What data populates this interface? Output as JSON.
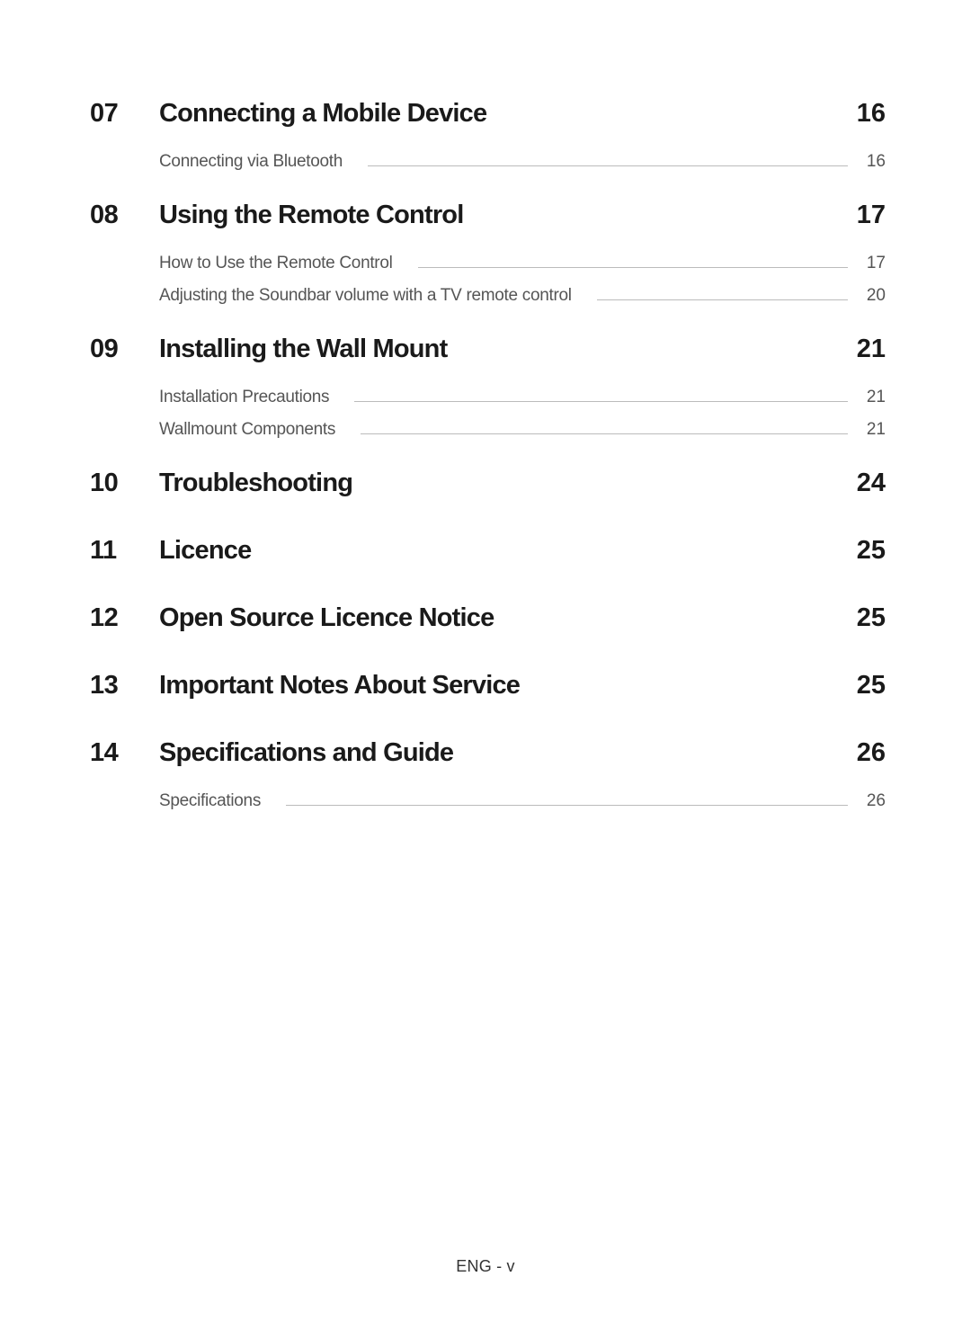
{
  "footer": "ENG - v",
  "sections": [
    {
      "num": "07",
      "title": "Connecting a Mobile Device",
      "page": "16",
      "subs": [
        {
          "title": "Connecting via Bluetooth",
          "page": "16"
        }
      ]
    },
    {
      "num": "08",
      "title": "Using the Remote Control",
      "page": "17",
      "subs": [
        {
          "title": "How to Use the Remote Control",
          "page": "17"
        },
        {
          "title": "Adjusting the Soundbar volume with a TV remote control",
          "page": "20"
        }
      ]
    },
    {
      "num": "09",
      "title": "Installing the Wall Mount",
      "page": "21",
      "subs": [
        {
          "title": "Installation Precautions",
          "page": "21"
        },
        {
          "title": "Wallmount Components",
          "page": "21"
        }
      ]
    },
    {
      "num": "10",
      "title": "Troubleshooting",
      "page": "24",
      "subs": []
    },
    {
      "num": "11",
      "title": "Licence",
      "page": "25",
      "subs": []
    },
    {
      "num": "12",
      "title": "Open Source Licence Notice",
      "page": "25",
      "subs": []
    },
    {
      "num": "13",
      "title": "Important Notes About Service",
      "page": "25",
      "subs": []
    },
    {
      "num": "14",
      "title": "Specifications and Guide",
      "page": "26",
      "subs": [
        {
          "title": "Specifications",
          "page": "26"
        }
      ]
    }
  ]
}
